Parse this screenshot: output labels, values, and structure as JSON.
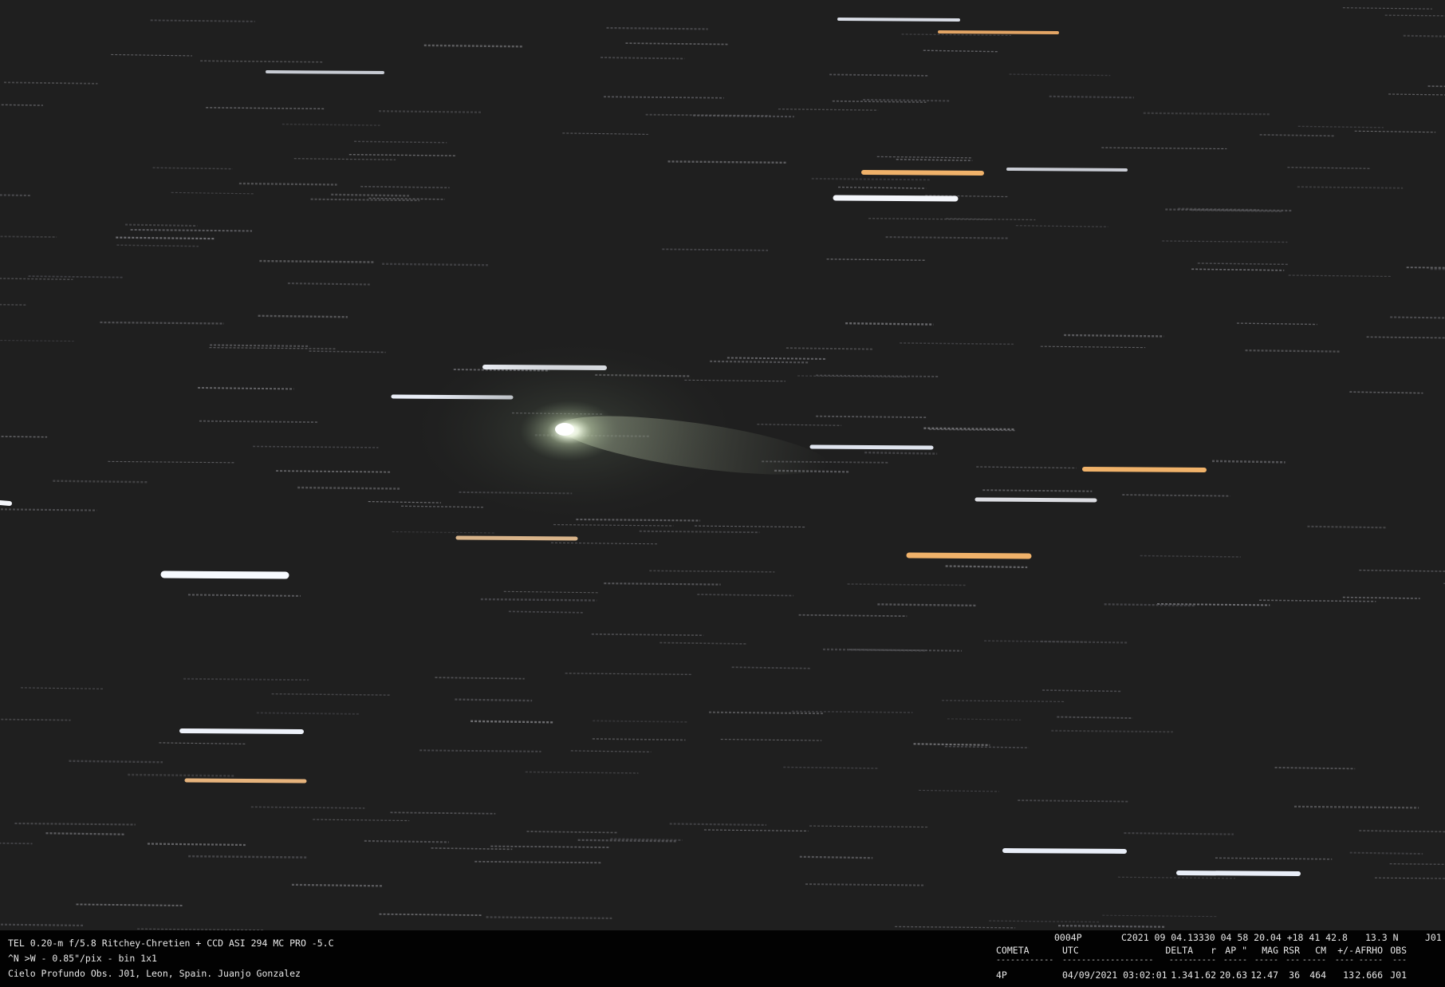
{
  "image": {
    "subject": "comet",
    "palette": {
      "sky": "#1f1f1f",
      "coma": "#e9f3dc",
      "tail": "#b9c7a6",
      "star_white": "#f4f6fb",
      "star_orange": "#f0b26a",
      "footer_bg": "#020202",
      "footer_text": "#e8e8e8"
    }
  },
  "caption": {
    "line1": "TEL 0.20-m f/5.8 Ritchey-Chretien + CCD ASI 294 MC PRO -5.C",
    "line2": "^N >W - 0.85\"/pix - bin 1x1",
    "line3": "Cielo Profundo Obs. J01, Leon, Spain. Juanjo Gonzalez"
  },
  "mpc": {
    "header": {
      "designation": "0004P",
      "obs_line": "C2021 09 04.13330 04 58 20.04 +18 41 42.8",
      "magnitude": "13.3 N",
      "code": "J01"
    },
    "columns": [
      "COMETA",
      "UTC",
      "DELTA",
      "r",
      "AP \"",
      "MAG",
      "RSR",
      "CM",
      "+/-",
      "AFRHO",
      "OBS"
    ],
    "dashes": [
      "------------",
      "-------------------",
      "-----",
      "-----",
      "-----",
      "-----",
      "---",
      "-----",
      "----",
      "-----",
      "---"
    ],
    "row": [
      "4P",
      "04/09/2021 03:02:01",
      "1.34",
      "1.62",
      "20.63",
      "12.47",
      "36",
      "464",
      "13",
      "2.666",
      "J01"
    ]
  }
}
